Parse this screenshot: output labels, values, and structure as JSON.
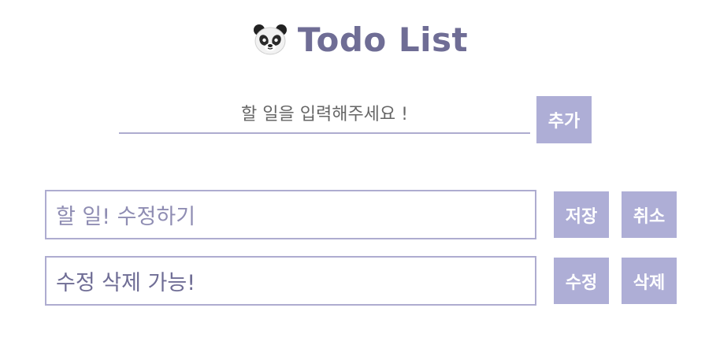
{
  "header": {
    "icon": "panda-icon",
    "title": "Todo List"
  },
  "add_form": {
    "placeholder": "할 일을 입력해주세요 !",
    "value": "",
    "button_label": "추가"
  },
  "todos": [
    {
      "mode": "editing",
      "input_value": "할 일! 수정하기",
      "primary_label": "저장",
      "secondary_label": "취소"
    },
    {
      "mode": "view",
      "text": "수정 삭제 가능!",
      "primary_label": "수정",
      "secondary_label": "삭제"
    }
  ],
  "colors": {
    "accent": "#aeaed6",
    "title": "#6f6d95",
    "border": "#aeacd0"
  }
}
